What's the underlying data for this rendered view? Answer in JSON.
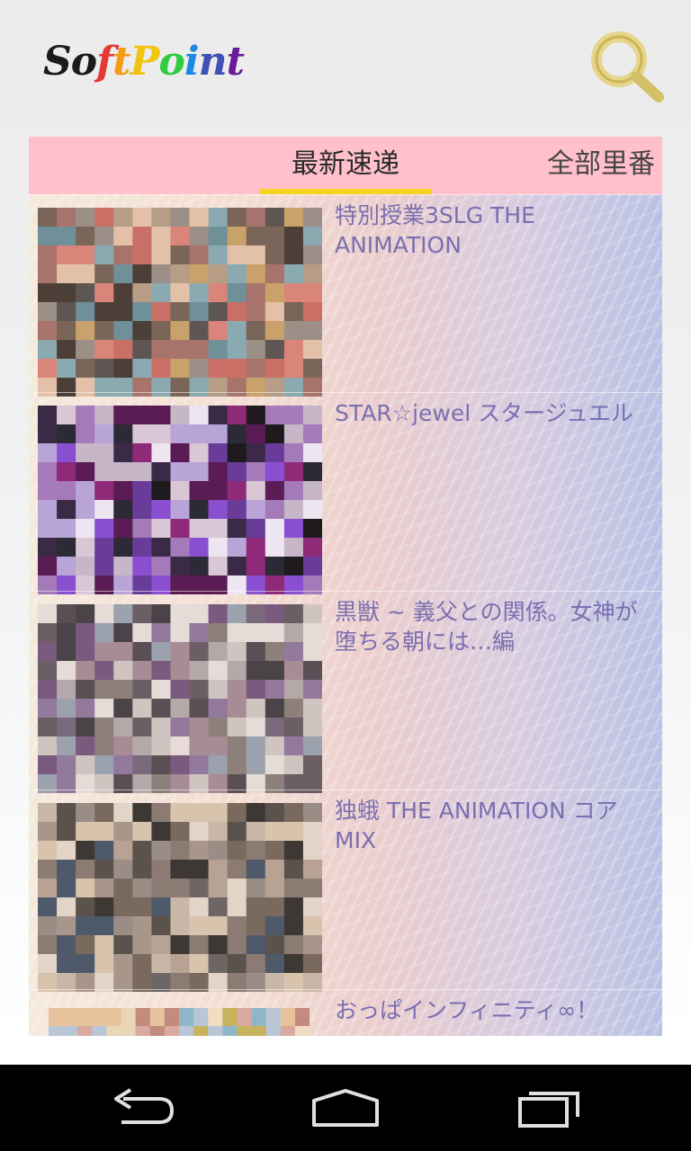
{
  "app": {
    "logo_letters": [
      {
        "ch": "S",
        "color": "#1a1a1a"
      },
      {
        "ch": "o",
        "color": "#1a1a1a"
      },
      {
        "ch": "f",
        "color": "#e53935"
      },
      {
        "ch": "t",
        "color": "#f39c12"
      },
      {
        "ch": "P",
        "color": "#f1c40f"
      },
      {
        "ch": "o",
        "color": "#2ecc40"
      },
      {
        "ch": "i",
        "color": "#1e88e5"
      },
      {
        "ch": "n",
        "color": "#3f51b5"
      },
      {
        "ch": "t",
        "color": "#6a1b9a"
      }
    ],
    "search_icon": "search-icon"
  },
  "tabs": {
    "active_label": "最新速递",
    "other_label": "全部里番",
    "indicator_color": "#f7d21f",
    "bar_color": "#ffc0cb"
  },
  "items": [
    {
      "title": "特別授業3SLG THE ANIMATION"
    },
    {
      "title": "STAR☆jewel スタージュエル"
    },
    {
      "title": "黒獣 ~ 義父との関係。女神が堕ちる朝には…編"
    },
    {
      "title": "独蛾 THE ANIMATION コアMIX"
    },
    {
      "title": "おっぱインフィニティ∞！"
    }
  ],
  "navigation": {
    "back_icon": "back-arrow-icon",
    "home_icon": "home-icon",
    "recents_icon": "recent-apps-icon"
  }
}
